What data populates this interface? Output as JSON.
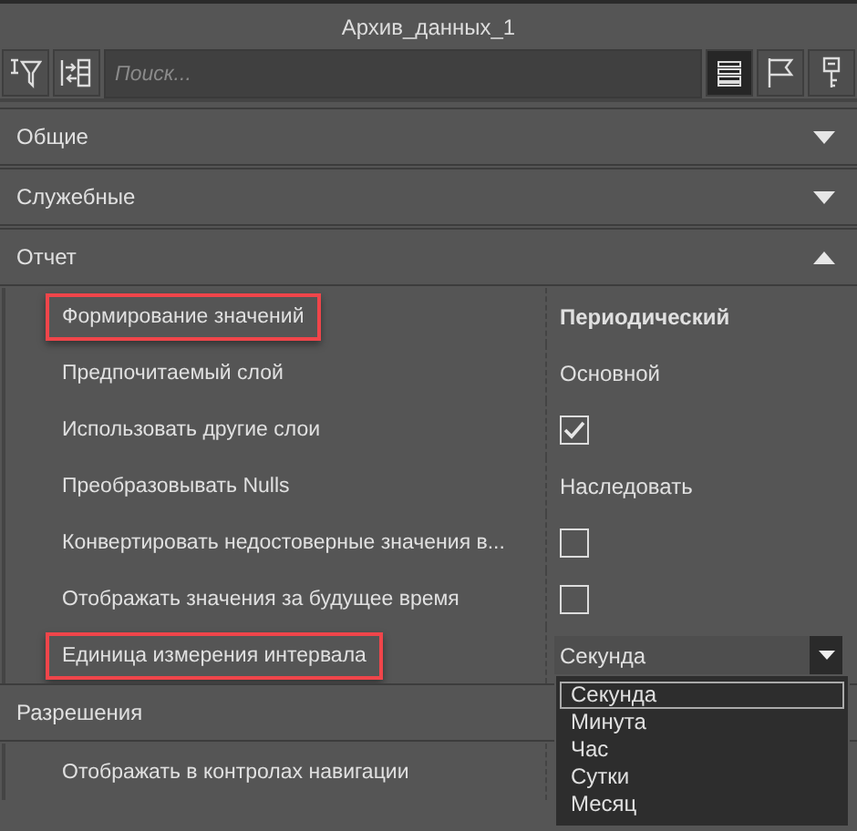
{
  "window": {
    "title": "Архив_данных_1"
  },
  "toolbar": {
    "search": {
      "placeholder": "Поиск..."
    },
    "view_buttons": [
      {
        "selected": true
      },
      {
        "selected": false
      },
      {
        "selected": false
      }
    ]
  },
  "sections": [
    {
      "title": "Общие",
      "expanded": false
    },
    {
      "title": "Служебные",
      "expanded": false
    },
    {
      "title": "Отчет",
      "expanded": true,
      "rows": [
        {
          "label": "Формирование значений",
          "kind": "text",
          "value": "Периодический",
          "bold": true,
          "highlighted": true
        },
        {
          "label": "Предпочитаемый слой",
          "kind": "text",
          "value": "Основной",
          "bold": false,
          "highlighted": false
        },
        {
          "label": "Использовать другие слои",
          "kind": "checkbox",
          "checked": true,
          "highlighted": false
        },
        {
          "label": "Преобразовывать Nulls",
          "kind": "text",
          "value": "Наследовать",
          "bold": false,
          "highlighted": false
        },
        {
          "label": "Конвертировать недостоверные значения в...",
          "kind": "checkbox",
          "checked": false,
          "highlighted": false
        },
        {
          "label": "Отображать значения за будущее время",
          "kind": "checkbox",
          "checked": false,
          "highlighted": false
        },
        {
          "label": "Единица измерения интервала",
          "kind": "dropdown",
          "value": "Секунда",
          "highlighted": true,
          "options": [
            {
              "label": "Секунда",
              "selected": true
            },
            {
              "label": "Минута",
              "selected": false
            },
            {
              "label": "Час",
              "selected": false
            },
            {
              "label": "Сутки",
              "selected": false
            },
            {
              "label": "Месяц",
              "selected": false
            }
          ]
        }
      ]
    },
    {
      "title": "Разрешения",
      "expanded": true,
      "rows": [
        {
          "label": "Отображать в контролах навигации",
          "kind": "empty",
          "highlighted": false
        }
      ]
    }
  ]
}
